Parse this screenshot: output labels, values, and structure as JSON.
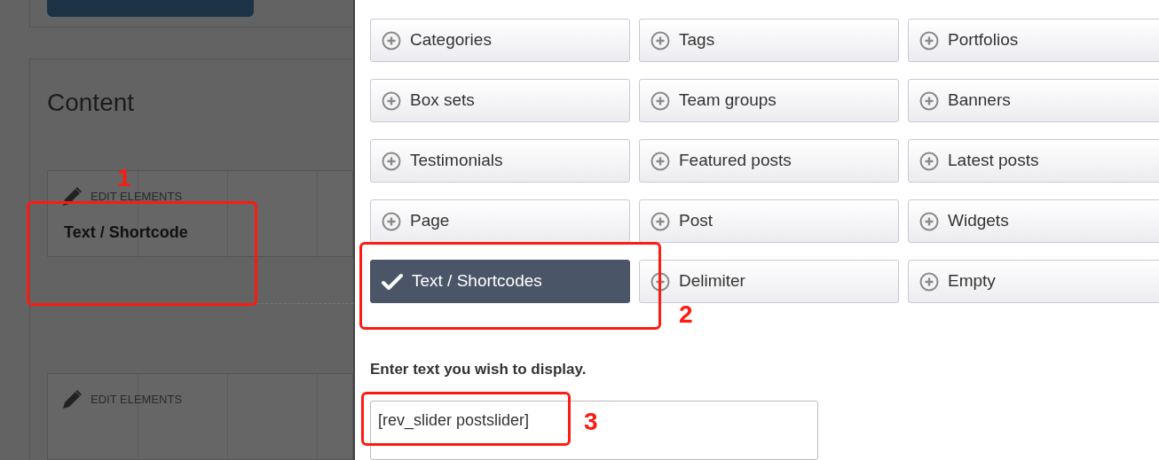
{
  "left_panel": {
    "section_title": "Content",
    "element_blocks": [
      {
        "action": "EDIT ELEMENTS",
        "title": "Text / Shortcode"
      },
      {
        "action": "EDIT ELEMENTS"
      }
    ]
  },
  "element_types": [
    {
      "label": "Categories",
      "selected": false
    },
    {
      "label": "Tags",
      "selected": false
    },
    {
      "label": "Portfolios",
      "selected": false
    },
    {
      "label": "Box sets",
      "selected": false
    },
    {
      "label": "Team groups",
      "selected": false
    },
    {
      "label": "Banners",
      "selected": false
    },
    {
      "label": "Testimonials",
      "selected": false
    },
    {
      "label": "Featured posts",
      "selected": false
    },
    {
      "label": "Latest posts",
      "selected": false
    },
    {
      "label": "Page",
      "selected": false
    },
    {
      "label": "Post",
      "selected": false
    },
    {
      "label": "Widgets",
      "selected": false
    },
    {
      "label": "Text / Shortcodes",
      "selected": true
    },
    {
      "label": "Delimiter",
      "selected": false
    },
    {
      "label": "Empty",
      "selected": false
    }
  ],
  "text_field": {
    "label": "Enter text you wish to display.",
    "value": "[rev_slider postslider]"
  },
  "annotations": [
    {
      "number": "1"
    },
    {
      "number": "2"
    },
    {
      "number": "3"
    }
  ]
}
